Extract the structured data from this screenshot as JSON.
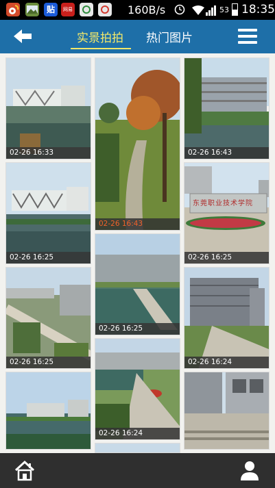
{
  "status_bar": {
    "app_icons": [
      "weibo-icon",
      "gallery-icon",
      "tieba-icon",
      "netease-icon",
      "camera-icon",
      "browser-icon"
    ],
    "tieba_label": "贴",
    "netease_label": "网易",
    "network_speed": "160B/s",
    "battery": "53",
    "time": "18:35"
  },
  "header": {
    "tabs": [
      {
        "label": "实景拍拍",
        "active": true
      },
      {
        "label": "热门图片",
        "active": false
      }
    ]
  },
  "gallery": {
    "photos": [
      {
        "timestamp": "02-26 16:33",
        "subject": "building-over-water"
      },
      {
        "timestamp": "02-26 16:25",
        "subject": "truss-building-lake"
      },
      {
        "timestamp": "02-26 16:25",
        "subject": "aerial-campus"
      },
      {
        "timestamp": "",
        "subject": "lakeside-campus"
      },
      {
        "timestamp": "02-26 16:43",
        "subject": "tree-path",
        "highlight": true
      },
      {
        "timestamp": "02-26 16:25",
        "subject": "bridge-pond"
      },
      {
        "timestamp": "02-26 16:24",
        "subject": "garden-plaza"
      },
      {
        "timestamp": "02-26 16:43",
        "subject": "building-lake"
      },
      {
        "timestamp": "02-26 16:25",
        "subject": "college-sign-flowers"
      },
      {
        "timestamp": "02-26 16:24",
        "subject": "grey-building"
      },
      {
        "timestamp": "",
        "subject": "stairs-buildings"
      }
    ],
    "college_sign": "东莞职业技术学院"
  },
  "colors": {
    "header_bg": "#1e6fa8",
    "active_tab": "#f3e86a",
    "highlight_caption": "#f0622a",
    "bottom_bar": "#2f2f2f"
  }
}
